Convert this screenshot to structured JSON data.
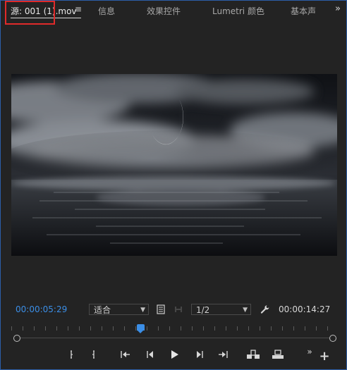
{
  "tabs": {
    "source": "源: 001 (1).mov",
    "menu_icon": "hamburger-icon",
    "info": "信息",
    "effect_controls": "效果控件",
    "lumetri": "Lumetri 颜色",
    "essential_sound": "基本声",
    "overflow": "»"
  },
  "colors": {
    "accent_blue": "#3b8ee6",
    "highlight_red": "#e02a2a",
    "panel_border": "#2b5ea8"
  },
  "controls": {
    "current_time": "00:00:05:29",
    "fit_select": "适合",
    "resolution_select": "1/2",
    "duration": "00:00:14:27"
  },
  "transport": {
    "overflow": "»",
    "add": "+"
  },
  "playhead_fraction": 0.4
}
